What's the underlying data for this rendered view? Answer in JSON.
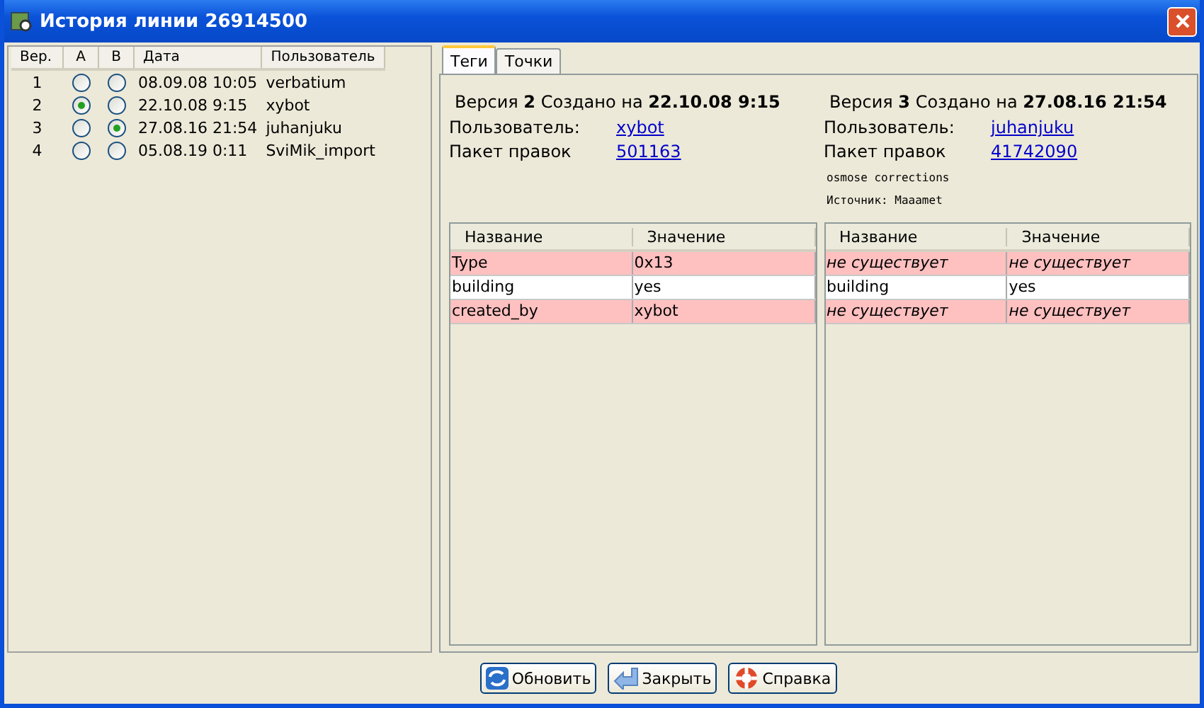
{
  "window": {
    "title": "История линии 26914500"
  },
  "history": {
    "columns": [
      "Вер.",
      "A",
      "B",
      "Дата",
      "Пользователь"
    ],
    "rows": [
      {
        "version": "1",
        "a_selected": false,
        "b_selected": false,
        "date": "08.09.08 10:05",
        "user": "verbatium"
      },
      {
        "version": "2",
        "a_selected": true,
        "b_selected": false,
        "date": "22.10.08 9:15",
        "user": "xybot"
      },
      {
        "version": "3",
        "a_selected": false,
        "b_selected": true,
        "date": "27.08.16 21:54",
        "user": "juhanjuku"
      },
      {
        "version": "4",
        "a_selected": false,
        "b_selected": false,
        "date": "05.08.19 0:11",
        "user": "SviMik_import"
      }
    ]
  },
  "tabs": [
    {
      "label": "Теги",
      "selected": true
    },
    {
      "label": "Точки",
      "selected": false
    }
  ],
  "versions": [
    {
      "heading": "Версия **2** Создано на **22.10.08 9:15**",
      "user_label": "Пользователь:",
      "user": "xybot",
      "changeset_label": "Пакет правок",
      "changeset": "501163",
      "table": {
        "columns": [
          "Название",
          "Значение"
        ],
        "rows": [
          {
            "differs": true,
            "cells": [
              {
                "text": "Type",
                "missing": false
              },
              {
                "text": "0x13",
                "missing": false
              }
            ]
          },
          {
            "differs": false,
            "cells": [
              {
                "text": "building",
                "missing": false
              },
              {
                "text": "yes",
                "missing": false
              }
            ]
          },
          {
            "differs": true,
            "cells": [
              {
                "text": "created_by",
                "missing": false
              },
              {
                "text": "xybot",
                "missing": false
              }
            ]
          }
        ]
      }
    },
    {
      "heading": "Версия **3** Создано на **27.08.16 21:54**",
      "user_label": "Пользователь:",
      "user": "juhanjuku",
      "changeset_label": "Пакет правок",
      "changeset": "41742090",
      "notes": [
        "osmose corrections",
        "Источник: Maaamet"
      ],
      "table": {
        "columns": [
          "Название",
          "Значение"
        ],
        "rows": [
          {
            "differs": true,
            "cells": [
              {
                "text": "не существует",
                "missing": true
              },
              {
                "text": "не существует",
                "missing": true
              }
            ]
          },
          {
            "differs": false,
            "cells": [
              {
                "text": "building",
                "missing": false
              },
              {
                "text": "yes",
                "missing": false
              }
            ]
          },
          {
            "differs": true,
            "cells": [
              {
                "text": "не существует",
                "missing": true
              },
              {
                "text": "не существует",
                "missing": true
              }
            ]
          }
        ]
      }
    }
  ],
  "buttons": [
    {
      "label": "Обновить",
      "kind": "refresh"
    },
    {
      "label": "Закрыть",
      "kind": "close"
    },
    {
      "label": "Справка",
      "kind": "help"
    }
  ]
}
